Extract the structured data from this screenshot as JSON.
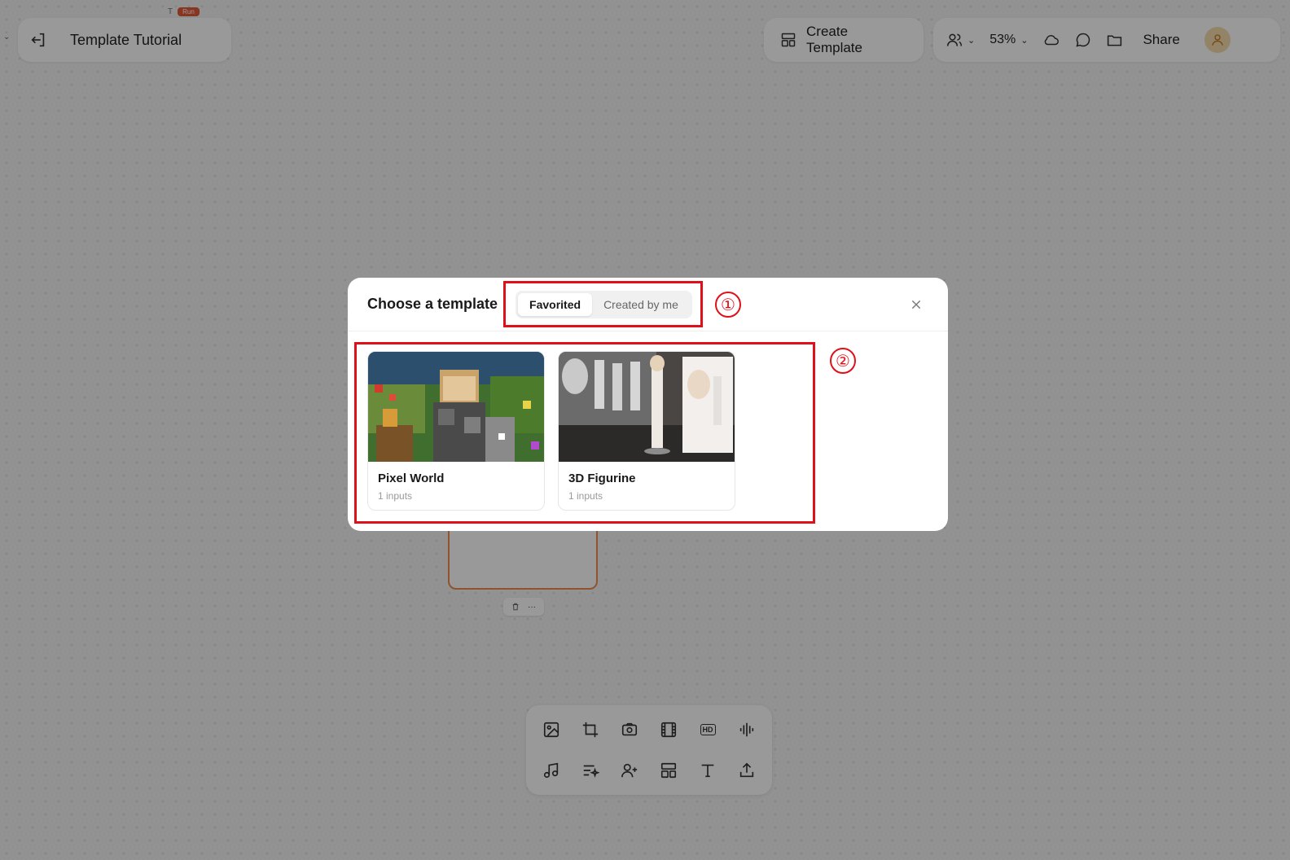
{
  "topbar": {
    "title": "Template Tutorial",
    "create_template": "Create Template",
    "zoom": "53%",
    "share": "Share",
    "mini_tab_label": "T",
    "run_badge": "Run"
  },
  "modal": {
    "title": "Choose a template",
    "tabs": [
      {
        "label": "Favorited",
        "active": true
      },
      {
        "label": "Created by me",
        "active": false
      }
    ],
    "cards": [
      {
        "name": "Pixel World",
        "inputs": "1 inputs"
      },
      {
        "name": "3D Figurine",
        "inputs": "1 inputs"
      }
    ]
  },
  "annotations": {
    "one": "①",
    "two": "②"
  },
  "colors": {
    "accent_orange": "#f08a4b",
    "annotation_red": "#e0101a",
    "avatar_bg": "#f6dcae"
  }
}
